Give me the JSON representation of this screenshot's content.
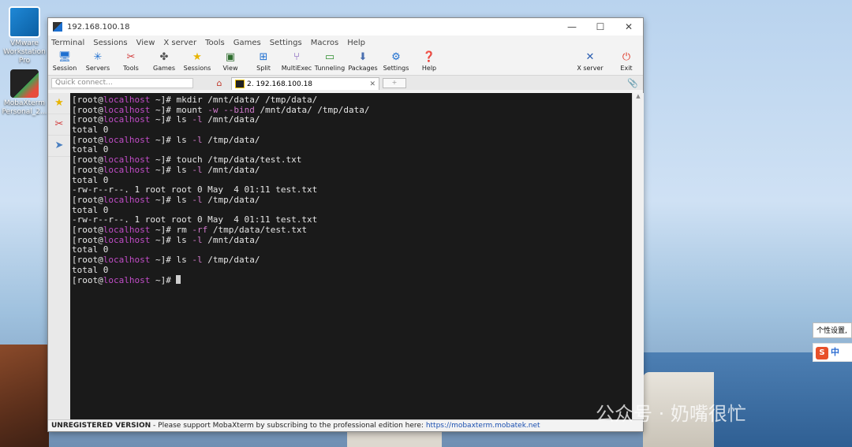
{
  "desktop": {
    "icons": [
      {
        "label": "VMware Workstation Pro"
      },
      {
        "label": "MobaXterm Personal_2..."
      }
    ],
    "watermark": "公众号 · 奶嘴很忙"
  },
  "window": {
    "title": "192.168.100.18",
    "controls": {
      "minimize": "—",
      "maximize": "☐",
      "close": "✕"
    }
  },
  "menu": [
    "Terminal",
    "Sessions",
    "View",
    "X server",
    "Tools",
    "Games",
    "Settings",
    "Macros",
    "Help"
  ],
  "toolbar": [
    {
      "label": "Session",
      "icon": "session-icon"
    },
    {
      "label": "Servers",
      "icon": "servers-icon"
    },
    {
      "label": "Tools",
      "icon": "tools-icon"
    },
    {
      "label": "Games",
      "icon": "games-icon"
    },
    {
      "label": "Sessions",
      "icon": "star-icon"
    },
    {
      "label": "View",
      "icon": "view-icon"
    },
    {
      "label": "Split",
      "icon": "split-icon"
    },
    {
      "label": "MultiExec",
      "icon": "multiexec-icon"
    },
    {
      "label": "Tunneling",
      "icon": "tunneling-icon"
    },
    {
      "label": "Packages",
      "icon": "packages-icon"
    },
    {
      "label": "Settings",
      "icon": "settings-icon"
    },
    {
      "label": "Help",
      "icon": "help-icon"
    }
  ],
  "toolbar_right": [
    {
      "label": "X server",
      "icon": "x-server-icon"
    },
    {
      "label": "Exit",
      "icon": "exit-icon"
    }
  ],
  "quick_connect": {
    "placeholder": "Quick connect..."
  },
  "tab": {
    "label": "2. 192.168.100.18"
  },
  "terminal": {
    "prompt_prefix": "[root@",
    "prompt_host": "localhost",
    "prompt_suffix": " ~]# ",
    "lines": [
      {
        "kind": "cmd",
        "parts": [
          [
            "t",
            "mkdir /mnt/data/ /tmp/data/"
          ]
        ]
      },
      {
        "kind": "cmd",
        "parts": [
          [
            "t",
            "mount "
          ],
          [
            "o",
            "-w --bind"
          ],
          [
            "t",
            " /mnt/data/ /tmp/data/"
          ]
        ]
      },
      {
        "kind": "cmd",
        "parts": [
          [
            "t",
            "ls "
          ],
          [
            "o",
            "-l"
          ],
          [
            "t",
            " /mnt/data/"
          ]
        ]
      },
      {
        "kind": "out",
        "text": "total 0"
      },
      {
        "kind": "cmd",
        "parts": [
          [
            "t",
            "ls "
          ],
          [
            "o",
            "-l"
          ],
          [
            "t",
            " /tmp/data/"
          ]
        ]
      },
      {
        "kind": "out",
        "text": "total 0"
      },
      {
        "kind": "cmd",
        "parts": [
          [
            "t",
            "touch /tmp/data/test.txt"
          ]
        ]
      },
      {
        "kind": "cmd",
        "parts": [
          [
            "t",
            "ls "
          ],
          [
            "o",
            "-l"
          ],
          [
            "t",
            " /mnt/data/"
          ]
        ]
      },
      {
        "kind": "out",
        "text": "total 0"
      },
      {
        "kind": "out",
        "text": "-rw-r--r--. 1 root root 0 May  4 01:11 test.txt"
      },
      {
        "kind": "cmd",
        "parts": [
          [
            "t",
            "ls "
          ],
          [
            "o",
            "-l"
          ],
          [
            "t",
            " /tmp/data/"
          ]
        ]
      },
      {
        "kind": "out",
        "text": "total 0"
      },
      {
        "kind": "out",
        "text": "-rw-r--r--. 1 root root 0 May  4 01:11 test.txt"
      },
      {
        "kind": "cmd",
        "parts": [
          [
            "t",
            "rm "
          ],
          [
            "o",
            "-rf"
          ],
          [
            "t",
            " /tmp/data/test.txt"
          ]
        ]
      },
      {
        "kind": "cmd",
        "parts": [
          [
            "t",
            "ls "
          ],
          [
            "o",
            "-l"
          ],
          [
            "t",
            " /mnt/data/"
          ]
        ]
      },
      {
        "kind": "out",
        "text": "total 0"
      },
      {
        "kind": "cmd",
        "parts": [
          [
            "t",
            "ls "
          ],
          [
            "o",
            "-l"
          ],
          [
            "t",
            " /tmp/data/"
          ]
        ]
      },
      {
        "kind": "out",
        "text": "total 0"
      },
      {
        "kind": "prompt"
      }
    ]
  },
  "status": {
    "unregistered": "UNREGISTERED VERSION",
    "message": " -  Please support MobaXterm by subscribing to the professional edition here: ",
    "link": "https://mobaxterm.mobatek.net"
  },
  "ime": {
    "tip": "个性设置,",
    "mode": "中"
  },
  "colors": {
    "terminal_bg": "#1a1a1a",
    "host": "#c14dc7",
    "option": "#d07acb",
    "link": "#1a4fb0"
  }
}
